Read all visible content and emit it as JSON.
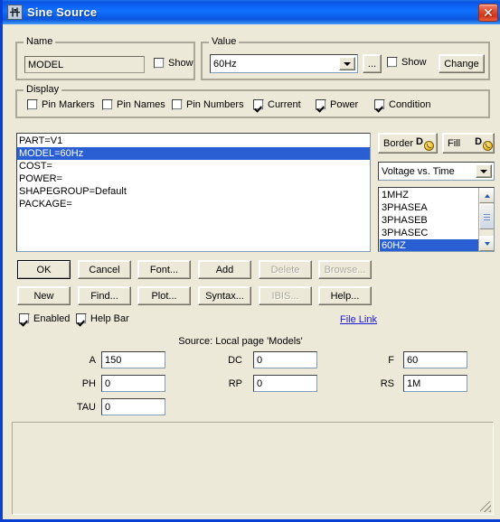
{
  "window": {
    "title": "Sine Source",
    "icon": "component-icon",
    "close_label": "✕",
    "accent_title_bg": "#0b5cf0",
    "dialog_bg": "#ece9d8",
    "selection_blue": "#2a5fd4"
  },
  "name_group": {
    "legend": "Name",
    "value": "MODEL",
    "show_label": "Show",
    "show_checked": false
  },
  "value_group": {
    "legend": "Value",
    "value": "60Hz",
    "ellipsis_label": "...",
    "show_label": "Show",
    "show_checked": false,
    "change_label": "Change"
  },
  "display_group": {
    "legend": "Display",
    "checkboxes": [
      {
        "label": "Pin Markers",
        "checked": false
      },
      {
        "label": "Pin Names",
        "checked": false
      },
      {
        "label": "Pin Numbers",
        "checked": false
      },
      {
        "label": "Current",
        "checked": true
      },
      {
        "label": "Power",
        "checked": true
      },
      {
        "label": "Condition",
        "checked": true
      }
    ]
  },
  "attributes_list": {
    "items": [
      {
        "text": "PART=V1",
        "selected": false
      },
      {
        "text": "MODEL=60Hz",
        "selected": true
      },
      {
        "text": "COST=",
        "selected": false
      },
      {
        "text": "POWER=",
        "selected": false
      },
      {
        "text": "SHAPEGROUP=Default",
        "selected": false
      },
      {
        "text": "PACKAGE=",
        "selected": false
      }
    ]
  },
  "shape_controls": {
    "border_label": "Border",
    "fill_label": "Fill",
    "plot_type": "Voltage vs. Time"
  },
  "model_list": {
    "items": [
      {
        "text": "1MHZ",
        "selected": false
      },
      {
        "text": "3PHASEA",
        "selected": false
      },
      {
        "text": "3PHASEB",
        "selected": false
      },
      {
        "text": "3PHASEC",
        "selected": false
      },
      {
        "text": "60HZ",
        "selected": true
      }
    ]
  },
  "buttons_row1": [
    {
      "label": "OK",
      "disabled": false,
      "default": true
    },
    {
      "label": "Cancel",
      "disabled": false,
      "default": false
    },
    {
      "label": "Font...",
      "disabled": false,
      "default": false
    },
    {
      "label": "Add",
      "disabled": false,
      "default": false
    },
    {
      "label": "Delete",
      "disabled": true,
      "default": false
    },
    {
      "label": "Browse...",
      "disabled": true,
      "default": false
    }
  ],
  "buttons_row2": [
    {
      "label": "New",
      "disabled": false,
      "default": false
    },
    {
      "label": "Find...",
      "disabled": false,
      "default": false
    },
    {
      "label": "Plot...",
      "disabled": false,
      "default": false
    },
    {
      "label": "Syntax...",
      "disabled": false,
      "default": false
    },
    {
      "label": "IBIS...",
      "disabled": true,
      "default": false
    },
    {
      "label": "Help...",
      "disabled": false,
      "default": false
    }
  ],
  "options_row": {
    "enabled_label": "Enabled",
    "enabled_checked": true,
    "help_bar_label": "Help Bar",
    "help_bar_checked": true,
    "file_link_label": "File Link"
  },
  "source_section": {
    "caption": "Source: Local page 'Models'",
    "params": [
      {
        "label": "A",
        "value": "150"
      },
      {
        "label": "DC",
        "value": "0"
      },
      {
        "label": "F",
        "value": "60"
      },
      {
        "label": "PH",
        "value": "0"
      },
      {
        "label": "RP",
        "value": "0"
      },
      {
        "label": "RS",
        "value": "1M"
      },
      {
        "label": "TAU",
        "value": "0"
      }
    ]
  }
}
